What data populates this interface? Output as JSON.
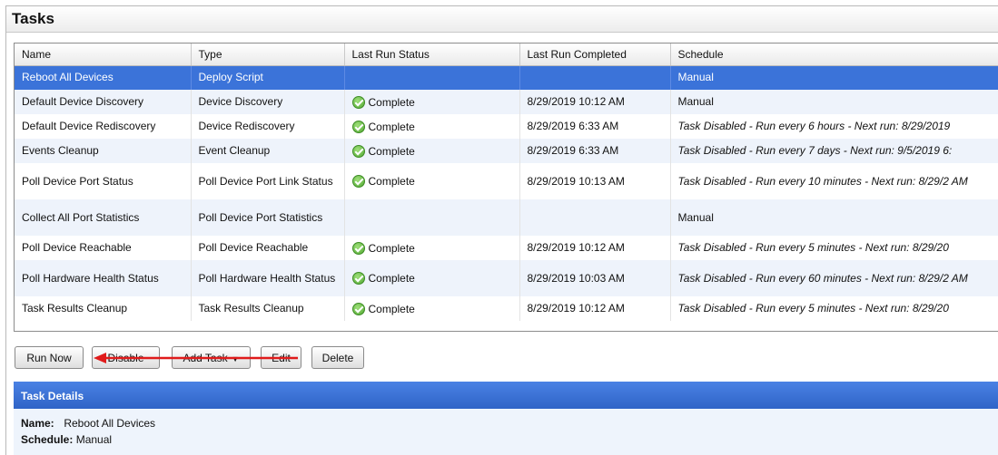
{
  "panel": {
    "title": "Tasks"
  },
  "table": {
    "columns": [
      "Name",
      "Type",
      "Last Run Status",
      "Last Run Completed",
      "Schedule"
    ],
    "rows": [
      {
        "name": "Reboot All Devices",
        "type": "Deploy Script",
        "status": "",
        "completed": "",
        "schedule": "Manual",
        "selected": true
      },
      {
        "name": "Default Device Discovery",
        "type": "Device Discovery",
        "status": "Complete",
        "completed": "8/29/2019 10:12 AM",
        "schedule": "Manual"
      },
      {
        "name": "Default Device Rediscovery",
        "type": "Device Rediscovery",
        "status": "Complete",
        "completed": "8/29/2019 6:33 AM",
        "schedule": "Task Disabled - Run every 6 hours - Next run: 8/29/2019"
      },
      {
        "name": "Events Cleanup",
        "type": "Event Cleanup",
        "status": "Complete",
        "completed": "8/29/2019 6:33 AM",
        "schedule": "Task Disabled - Run every 7 days - Next run: 9/5/2019 6:"
      },
      {
        "name": "Poll Device Port Status",
        "type": "Poll Device Port Link Status",
        "status": "Complete",
        "completed": "8/29/2019 10:13 AM",
        "schedule": "Task Disabled - Run every 10 minutes - Next run: 8/29/2 AM"
      },
      {
        "name": "Collect All Port Statistics",
        "type": "Poll Device Port Statistics",
        "status": "",
        "completed": "",
        "schedule": "Manual"
      },
      {
        "name": "Poll Device Reachable",
        "type": "Poll Device Reachable",
        "status": "Complete",
        "completed": "8/29/2019 10:12 AM",
        "schedule": "Task Disabled - Run every 5 minutes - Next run: 8/29/20"
      },
      {
        "name": "Poll Hardware Health Status",
        "type": "Poll Hardware Health Status",
        "status": "Complete",
        "completed": "8/29/2019 10:03 AM",
        "schedule": "Task Disabled - Run every 60 minutes - Next run: 8/29/2 AM"
      },
      {
        "name": "Task Results Cleanup",
        "type": "Task Results Cleanup",
        "status": "Complete",
        "completed": "8/29/2019 10:12 AM",
        "schedule": "Task Disabled - Run every 5 minutes - Next run: 8/29/20"
      }
    ]
  },
  "toolbar": {
    "run_now": "Run Now",
    "disable": "Disable",
    "add_task": "Add Task",
    "edit": "Edit",
    "delete": "Delete"
  },
  "details": {
    "header": "Task Details",
    "name_label": "Name:",
    "name_value": "Reboot All Devices",
    "schedule_label": "Schedule:",
    "schedule_value": "Manual"
  },
  "colors": {
    "selected_row": "#3b73d9",
    "alt_row": "#eef3fb",
    "details_header": "#2f64c7",
    "annotation_arrow": "#e01b1b",
    "complete_icon": "#52a833"
  },
  "icons": {
    "status": "check-circle-icon",
    "dropdown": "caret-down-icon"
  }
}
